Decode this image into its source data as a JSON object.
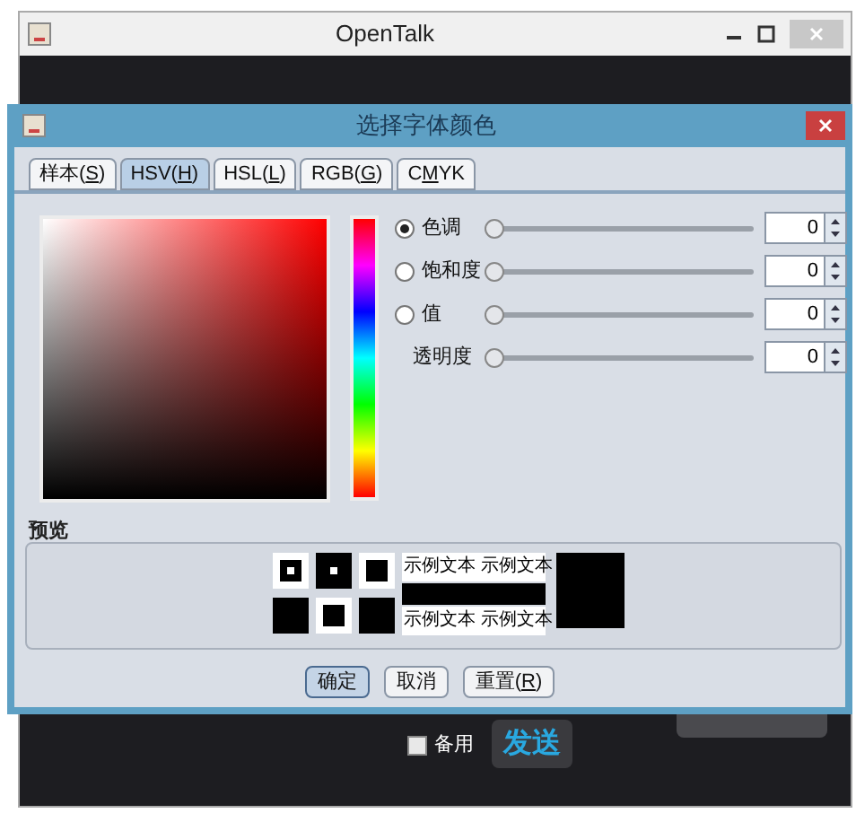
{
  "main_window": {
    "title": "OpenTalk",
    "backup": {
      "label": "备用",
      "checked": false
    },
    "send_button": "发送"
  },
  "dialog": {
    "title": "选择字体颜色",
    "tabs": [
      {
        "before": "样本(",
        "key": "S",
        "after": ")",
        "selected": false
      },
      {
        "before": "HSV(",
        "key": "H",
        "after": ")",
        "selected": true
      },
      {
        "before": "HSL(",
        "key": "L",
        "after": ")",
        "selected": false
      },
      {
        "before": "RGB(",
        "key": "G",
        "after": ")",
        "selected": false
      },
      {
        "before": "C",
        "key": "M",
        "after": "YK",
        "selected": false
      }
    ],
    "channels": [
      {
        "label": "色调",
        "kind": "radio",
        "selected": true,
        "level": 0,
        "value": "0"
      },
      {
        "label": "饱和度",
        "kind": "radio",
        "selected": false,
        "level": 0,
        "value": "0"
      },
      {
        "label": "值",
        "kind": "radio",
        "selected": false,
        "level": 0,
        "value": "0"
      },
      {
        "label": "透明度",
        "kind": "plain",
        "level": 0,
        "value": "0"
      }
    ],
    "preview": {
      "label": "预览",
      "color": "#000000",
      "sample_texts": [
        "示例文本",
        "示例文本",
        "示例文本",
        "示例文本"
      ]
    },
    "buttons": [
      {
        "before": "确定",
        "selected": true
      },
      {
        "before": "取消",
        "selected": false
      },
      {
        "before": "重置(",
        "key": "R",
        "after": ")",
        "selected": false
      }
    ]
  }
}
